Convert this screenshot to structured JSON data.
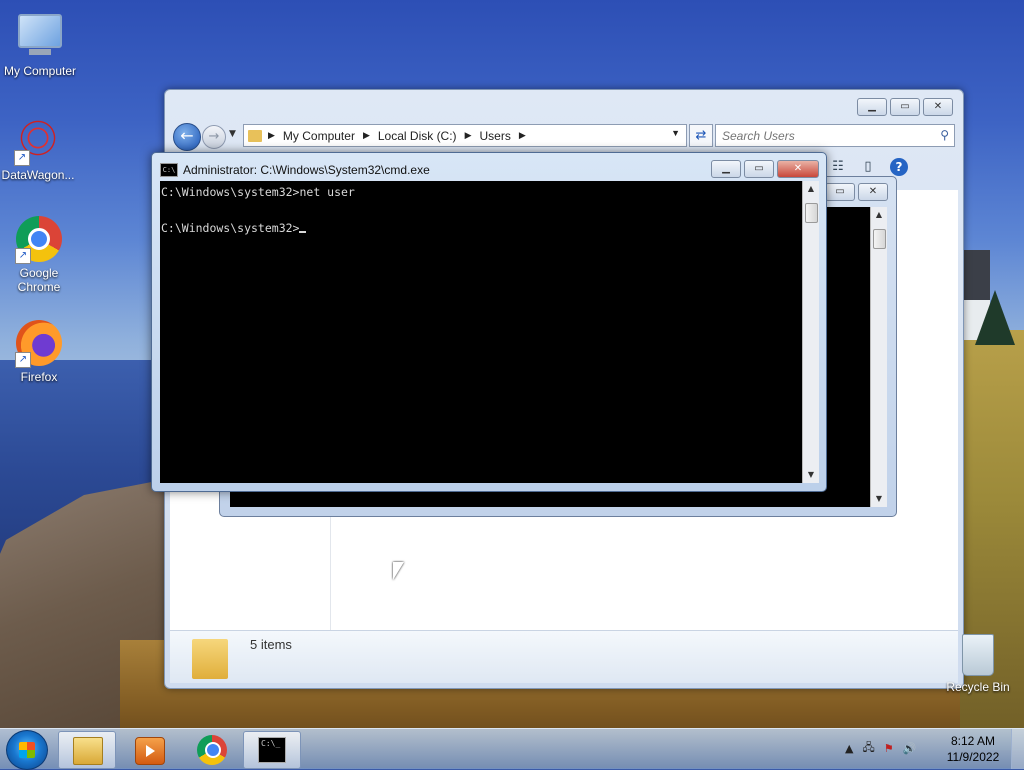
{
  "desktop": {
    "icons": [
      {
        "label": "My Computer"
      },
      {
        "label": "DataWagon..."
      },
      {
        "label": "Google Chrome"
      },
      {
        "label": "Firefox"
      },
      {
        "label": "Recycle Bin"
      }
    ]
  },
  "explorer": {
    "breadcrumb": [
      "My Computer",
      "Local Disk (C:)",
      "Users"
    ],
    "search_placeholder": "Search Users",
    "status": "5 items"
  },
  "cmd": {
    "title": "Administrator: C:\\Windows\\System32\\cmd.exe",
    "lines": [
      "C:\\Windows\\system32>net user",
      "",
      "C:\\Windows\\system32>"
    ]
  },
  "taskbar": {
    "clock_time": "8:12 AM",
    "clock_date": "11/9/2022"
  },
  "icons": {
    "start": "windows-flag-icon",
    "tray": [
      "show-hidden-icons",
      "network-icon",
      "action-center-flag-icon",
      "volume-icon"
    ]
  },
  "colors": {
    "console_bg": "#000000",
    "console_fg": "#d8d8d8",
    "close_button": "#c8473a"
  }
}
